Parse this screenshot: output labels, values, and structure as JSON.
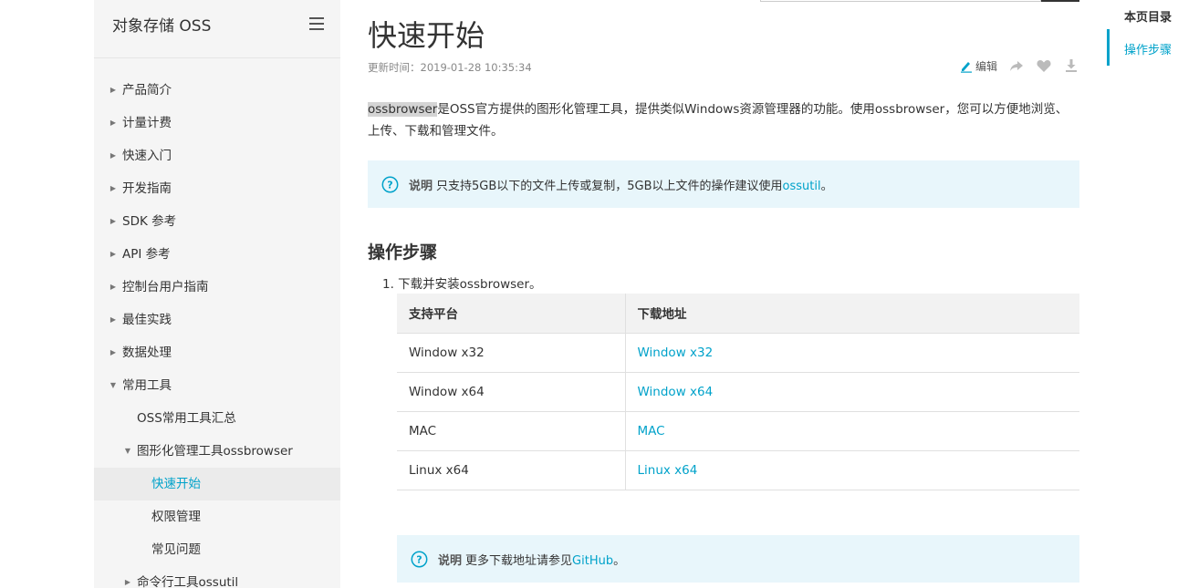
{
  "sidebar": {
    "title": "对象存储 OSS",
    "items": [
      {
        "label": "产品简介",
        "level": 1,
        "arrow": "right"
      },
      {
        "label": "计量计费",
        "level": 1,
        "arrow": "right"
      },
      {
        "label": "快速入门",
        "level": 1,
        "arrow": "right"
      },
      {
        "label": "开发指南",
        "level": 1,
        "arrow": "right"
      },
      {
        "label": "SDK 参考",
        "level": 1,
        "arrow": "right"
      },
      {
        "label": "API 参考",
        "level": 1,
        "arrow": "right"
      },
      {
        "label": "控制台用户指南",
        "level": 1,
        "arrow": "right"
      },
      {
        "label": "最佳实践",
        "level": 1,
        "arrow": "right"
      },
      {
        "label": "数据处理",
        "level": 1,
        "arrow": "right"
      },
      {
        "label": "常用工具",
        "level": 1,
        "arrow": "down"
      },
      {
        "label": "OSS常用工具汇总",
        "level": 2,
        "arrow": "none"
      },
      {
        "label": "图形化管理工具ossbrowser",
        "level": 2,
        "arrow": "down"
      },
      {
        "label": "快速开始",
        "level": 3,
        "arrow": "none",
        "active": true
      },
      {
        "label": "权限管理",
        "level": 3,
        "arrow": "none"
      },
      {
        "label": "常见问题",
        "level": 3,
        "arrow": "none"
      },
      {
        "label": "命令行工具ossutil",
        "level": 2,
        "arrow": "right"
      }
    ]
  },
  "main": {
    "title": "快速开始",
    "update_time": "更新时间：2019-01-28 10:35:34",
    "edit_label": "编辑",
    "intro_highlight": "ossbrowser",
    "intro_rest": "是OSS官方提供的图形化管理工具，提供类似Windows资源管理器的功能。使用ossbrowser，您可以方便地浏览、上传、下载和管理文件。",
    "note1": {
      "label": "说明",
      "text": "只支持5GB以下的文件上传或复制，5GB以上文件的操作建议使用",
      "link": "ossutil",
      "suffix": "。"
    },
    "section_title": "操作步骤",
    "step1": "下载并安装ossbrowser。",
    "table": {
      "headers": [
        "支持平台",
        "下载地址"
      ],
      "rows": [
        {
          "platform": "Window x32",
          "link": "Window x32"
        },
        {
          "platform": "Window x64",
          "link": "Window x64"
        },
        {
          "platform": "MAC",
          "link": "MAC"
        },
        {
          "platform": "Linux x64",
          "link": "Linux x64"
        }
      ]
    },
    "note2": {
      "label": "说明",
      "text": "更多下载地址请参见",
      "link": "GitHub",
      "suffix": "。"
    }
  },
  "toc": {
    "title": "本页目录",
    "items": [
      "操作步骤"
    ]
  },
  "colors": {
    "accent": "#00a2ca",
    "sidebar_bg": "#f5f5f5",
    "note_bg": "#e8f6fb"
  },
  "icons": [
    "menu-icon",
    "pencil-icon",
    "share-icon",
    "heart-icon",
    "download-icon",
    "question-icon"
  ]
}
